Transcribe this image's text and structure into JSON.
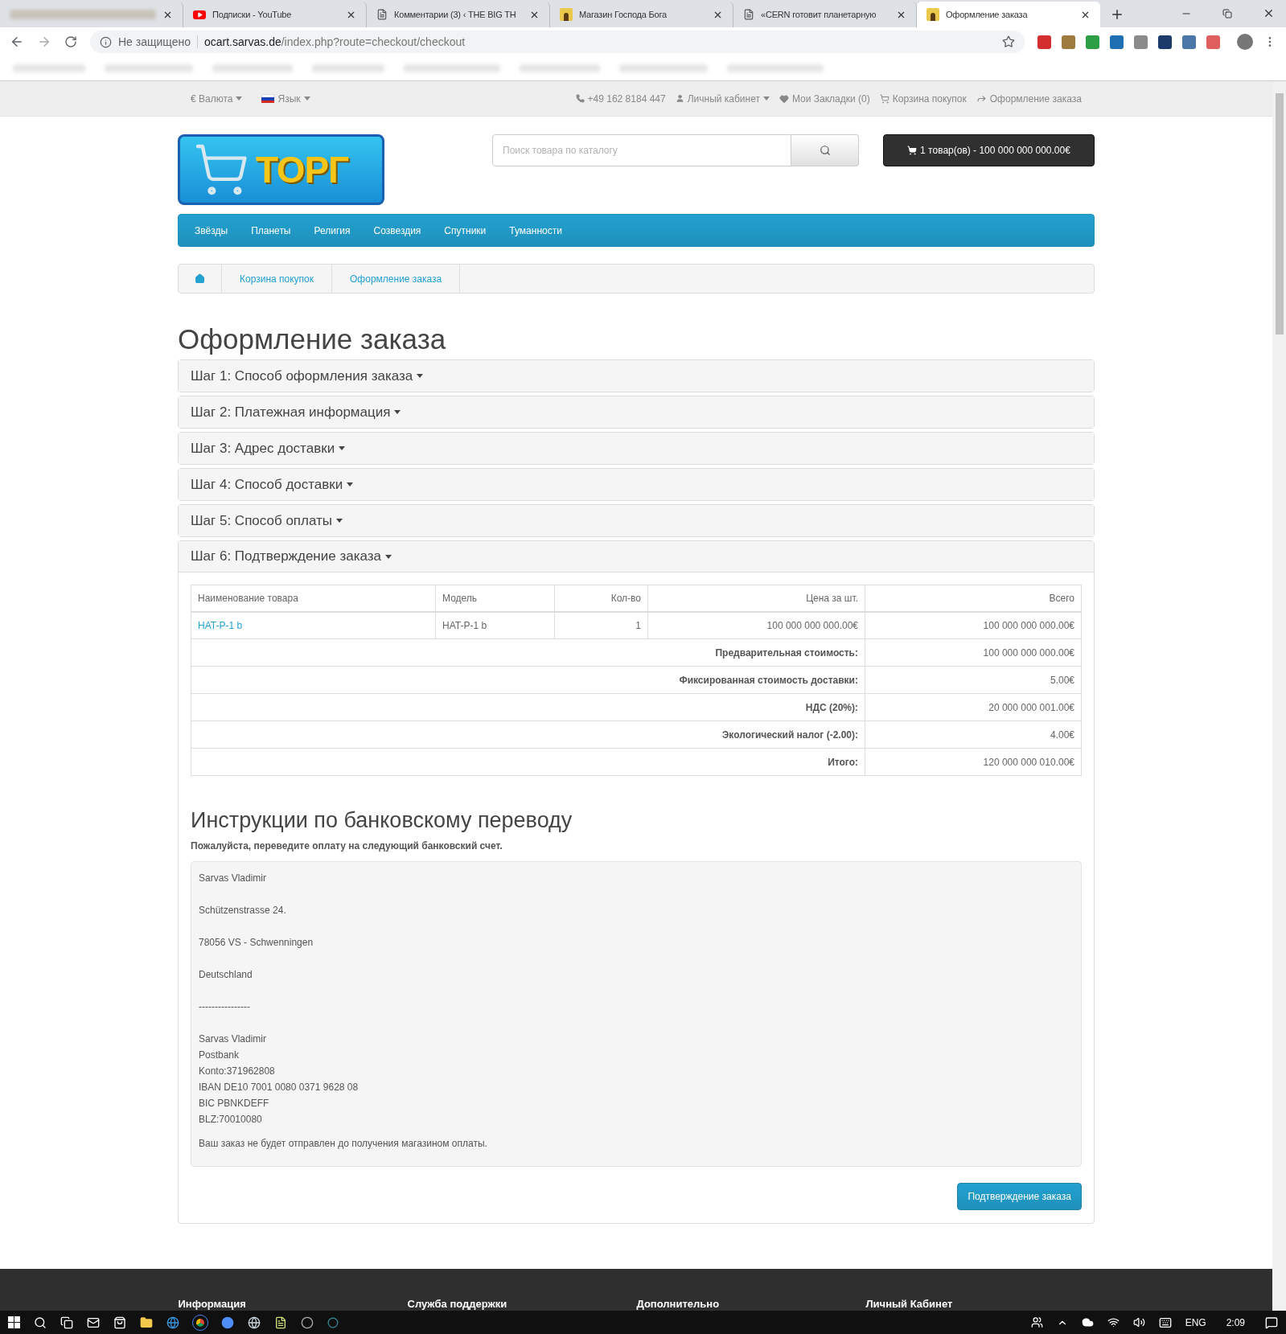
{
  "browser": {
    "tabs": [
      {
        "selected": false
      },
      {
        "title": "Подписки - YouTube",
        "kind": "video",
        "selected": false
      },
      {
        "title": "Комментарии (3) ‹ THE BIG TH",
        "kind": "page",
        "selected": false
      },
      {
        "title": "Магазин Господа Бога",
        "kind": "figure",
        "selected": false
      },
      {
        "title": "«CERN готовит планетарную",
        "kind": "page",
        "selected": false
      },
      {
        "title": "Оформление заказа",
        "kind": "figure",
        "selected": true
      }
    ],
    "security": "Не защищено",
    "url_host": "ocart.sarvas.de",
    "url_path": "/index.php?route=checkout/checkout"
  },
  "top_bar": {
    "currency": "€ Валюта",
    "language": "Язык",
    "phone": "+49 162 8184 447",
    "account": "Личный кабинет",
    "wishlist": "Мои Закладки (0)",
    "cart": "Корзина покупок",
    "checkout": "Оформление заказа"
  },
  "header": {
    "logo": "ТОРГ",
    "search": {
      "placeholder": "Поиск товара по каталогу"
    },
    "cart_button": "1 товар(ов) - 100 000 000 000.00€"
  },
  "menu": [
    "Звёзды",
    "Планеты",
    "Религия",
    "Созвездия",
    "Спутники",
    "Туманности"
  ],
  "breadcrumb": [
    "Корзина покупок",
    "Оформление заказа"
  ],
  "heading": "Оформление заказа",
  "steps": [
    {
      "title": "Шаг 1: Способ оформления заказа",
      "expanded": false
    },
    {
      "title": "Шаг 2: Платежная информация",
      "expanded": false
    },
    {
      "title": "Шаг 3: Адрес доставки",
      "expanded": false
    },
    {
      "title": "Шаг 4: Способ доставки",
      "expanded": false
    },
    {
      "title": "Шаг 5: Способ оплаты",
      "expanded": false
    },
    {
      "title": "Шаг 6: Подтверждение заказа",
      "expanded": true
    }
  ],
  "table": {
    "columns": [
      "Наименование товара",
      "Модель",
      "Кол-во",
      "Цена за шт.",
      "Всего"
    ],
    "rows": [
      [
        "HAT-P-1 b",
        "HAT-P-1 b",
        "1",
        "100 000 000 000.00€",
        "100 000 000 000.00€"
      ]
    ],
    "totals": [
      {
        "label": "Предварительная стоимость:",
        "value": "100 000 000 000.00€"
      },
      {
        "label": "Фиксированная стоимость доставки:",
        "value": "5.00€"
      },
      {
        "label": "НДС (20%):",
        "value": "20 000 000 001.00€"
      },
      {
        "label": "Экологический налог (-2.00):",
        "value": "4.00€"
      },
      {
        "label": "Итого:",
        "value": "120 000 000 010.00€"
      }
    ]
  },
  "bank": {
    "heading": "Инструкции по банковскому переводу",
    "note": "Пожалуйста, переведите оплату на следующий банковский счет.",
    "blocks": [
      [
        "Sarvas Vladimir"
      ],
      [
        "Schützenstrasse 24."
      ],
      [
        "78056 VS - Schwenningen"
      ],
      [
        "Deutschland"
      ],
      [
        "----------------"
      ],
      [
        "Sarvas Vladimir",
        "Postbank",
        "Konto:371962808",
        "IBAN DE10 7001 0080 0371 9628 08",
        "BIC PBNKDEFF",
        "BLZ:70010080"
      ]
    ],
    "warning": "Ваш заказ не будет отправлен до получения магазином оплаты."
  },
  "confirm_button": "Подтверждение заказа",
  "footer": [
    "Информация",
    "Служба поддержки",
    "Дополнительно",
    "Личный Кабинет"
  ],
  "taskbar": {
    "language": "ENG",
    "time": "2:09"
  }
}
